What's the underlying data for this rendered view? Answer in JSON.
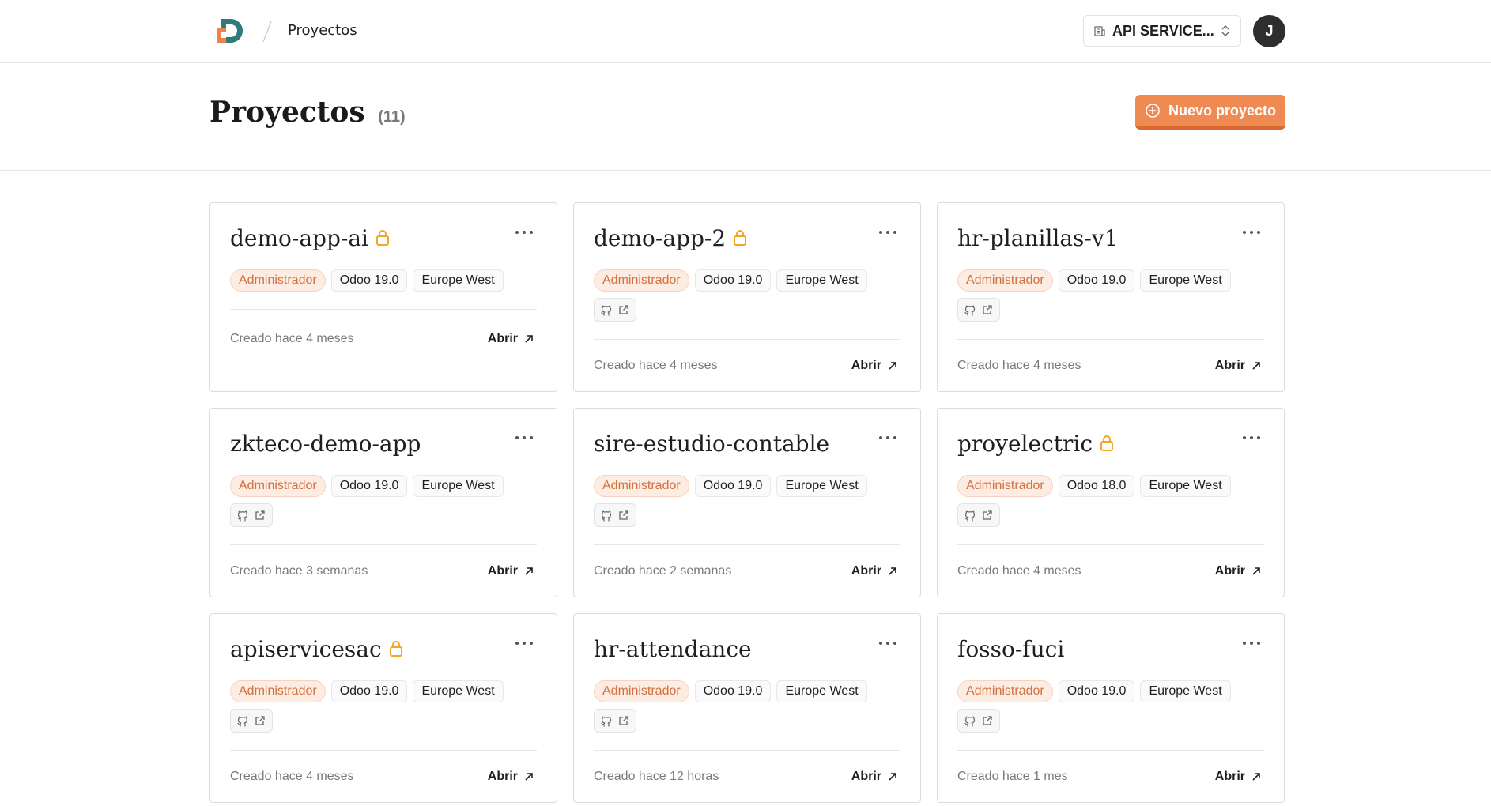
{
  "topbar": {
    "crumb": "Proyectos",
    "org_name": "API SERVICE...",
    "avatar_initial": "J"
  },
  "header": {
    "title": "Proyectos",
    "count": "(11)",
    "new_button_label": "Nuevo proyecto"
  },
  "colors": {
    "accent": "#ef8a52",
    "role_tag_text": "#d2703f",
    "lock": "#f2a623"
  },
  "open_label": "Abrir",
  "projects": [
    {
      "name": "demo-app-ai",
      "locked": true,
      "role": "Administrador",
      "version": "Odoo 19.0",
      "region": "Europe West",
      "links": false,
      "created": "Creado hace 4 meses"
    },
    {
      "name": "demo-app-2",
      "locked": true,
      "role": "Administrador",
      "version": "Odoo 19.0",
      "region": "Europe West",
      "links": true,
      "created": "Creado hace 4 meses"
    },
    {
      "name": "hr-planillas-v1",
      "locked": false,
      "role": "Administrador",
      "version": "Odoo 19.0",
      "region": "Europe West",
      "links": true,
      "created": "Creado hace 4 meses"
    },
    {
      "name": "zkteco-demo-app",
      "locked": false,
      "role": "Administrador",
      "version": "Odoo 19.0",
      "region": "Europe West",
      "links": true,
      "created": "Creado hace 3 semanas"
    },
    {
      "name": "sire-estudio-contable",
      "locked": false,
      "role": "Administrador",
      "version": "Odoo 19.0",
      "region": "Europe West",
      "links": true,
      "created": "Creado hace 2 semanas"
    },
    {
      "name": "proyelectric",
      "locked": true,
      "role": "Administrador",
      "version": "Odoo 18.0",
      "region": "Europe West",
      "links": true,
      "created": "Creado hace 4 meses"
    },
    {
      "name": "apiservicesac",
      "locked": true,
      "role": "Administrador",
      "version": "Odoo 19.0",
      "region": "Europe West",
      "links": true,
      "created": "Creado hace 4 meses"
    },
    {
      "name": "hr-attendance",
      "locked": false,
      "role": "Administrador",
      "version": "Odoo 19.0",
      "region": "Europe West",
      "links": true,
      "created": "Creado hace 12 horas"
    },
    {
      "name": "fosso-fuci",
      "locked": false,
      "role": "Administrador",
      "version": "Odoo 19.0",
      "region": "Europe West",
      "links": true,
      "created": "Creado hace 1 mes"
    }
  ]
}
